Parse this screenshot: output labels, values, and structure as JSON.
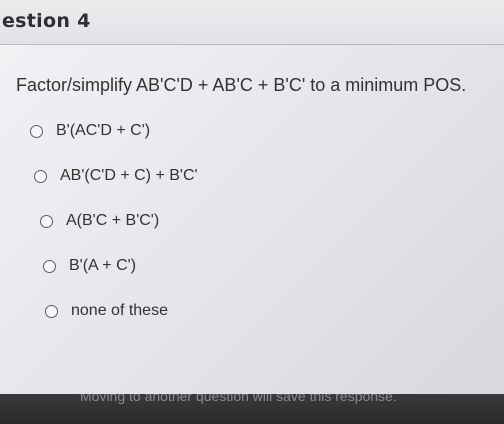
{
  "header": {
    "title": "estion 4"
  },
  "question": {
    "text": "Factor/simplify AB'C'D + AB'C + B'C' to a minimum POS."
  },
  "options": [
    {
      "label": "B'(AC'D + C')"
    },
    {
      "label": "AB'(C'D + C) + B'C'"
    },
    {
      "label": "A(B'C + B'C')"
    },
    {
      "label": "B'(A + C')"
    },
    {
      "label": "none of these"
    }
  ],
  "footer": {
    "notice": "Moving to another question will save this response."
  }
}
